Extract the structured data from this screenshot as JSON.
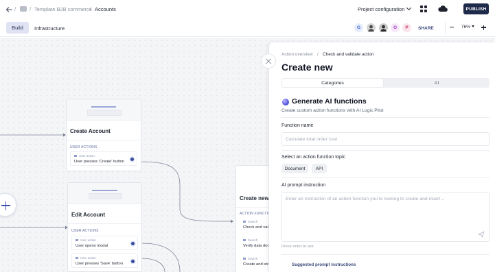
{
  "header": {
    "breadcrumb": {
      "sep": "/",
      "project": "Template B2B commerce",
      "current": "Accounts"
    },
    "project_config": "Project configuration",
    "publish_label": "PUBLISH",
    "icons": [
      "back-arrow-icon",
      "project-icon",
      "apps-grid-icon",
      "cloud-icon"
    ]
  },
  "subbar": {
    "tabs": [
      {
        "label": "Build",
        "active": true
      },
      {
        "label": "Infrastructure",
        "active": false
      }
    ],
    "avatars": [
      {
        "letter": "G",
        "color": "#3a63c9",
        "bg": "#e6ecfb"
      },
      {
        "letter": "",
        "color": "#333",
        "bg": "#d9d9d9"
      },
      {
        "letter": "",
        "color": "#333",
        "bg": "#cfcfcf"
      },
      {
        "letter": "O",
        "color": "#a13fb8",
        "bg": "#f6e6fa"
      },
      {
        "letter": "P",
        "color": "#c4346a",
        "bg": "#fbe6ee"
      }
    ],
    "share_label": "SHARE",
    "zoom": "76%"
  },
  "canvas": {
    "nodes": [
      {
        "title": "Create Account",
        "section": "USER ACTIONS",
        "actions": [
          {
            "tag": "User action",
            "text": "User presses 'Create' button"
          }
        ]
      },
      {
        "title": "Edit Account",
        "section": "USER ACTIONS",
        "actions": [
          {
            "tag": "User action",
            "text": "User opens modal"
          },
          {
            "tag": "User action",
            "text": "User presses 'Save' button"
          }
        ]
      },
      {
        "title": "Create new",
        "section": "ACTION FUNCTION",
        "actions": [
          {
            "tag": "Search",
            "text": "Check and vali"
          },
          {
            "tag": "Search",
            "text": "Verify data doc"
          },
          {
            "tag": "Search",
            "text": "Create and stor"
          }
        ]
      }
    ]
  },
  "panel": {
    "breadcrumb": {
      "parent": "Action overview",
      "sep": "/",
      "current": "Check and validate action"
    },
    "title": "Create new",
    "segments": [
      "Categories",
      "AI"
    ],
    "active_segment": "Categories",
    "generate_title": "Generate AI functions",
    "generate_subtitle": "Create custom action functions with AI Logic Pilot",
    "function_name": {
      "label": "Function name",
      "placeholder": "Calculate total order cost",
      "value": ""
    },
    "topic": {
      "label": "Select an action function topic",
      "options": [
        "Document",
        "API"
      ]
    },
    "prompt": {
      "label": "AI prompt instruction",
      "placeholder": "Enter an instruction of an action function you’re looking to create and insert…",
      "hint": "Press enter to ask"
    },
    "suggested_label": "Suggested prompt instructions"
  },
  "colors": {
    "accent": "#1e2a4a",
    "build_tab_bg": "#dfe3f3",
    "canvas_bg": "#f4f5f7"
  }
}
